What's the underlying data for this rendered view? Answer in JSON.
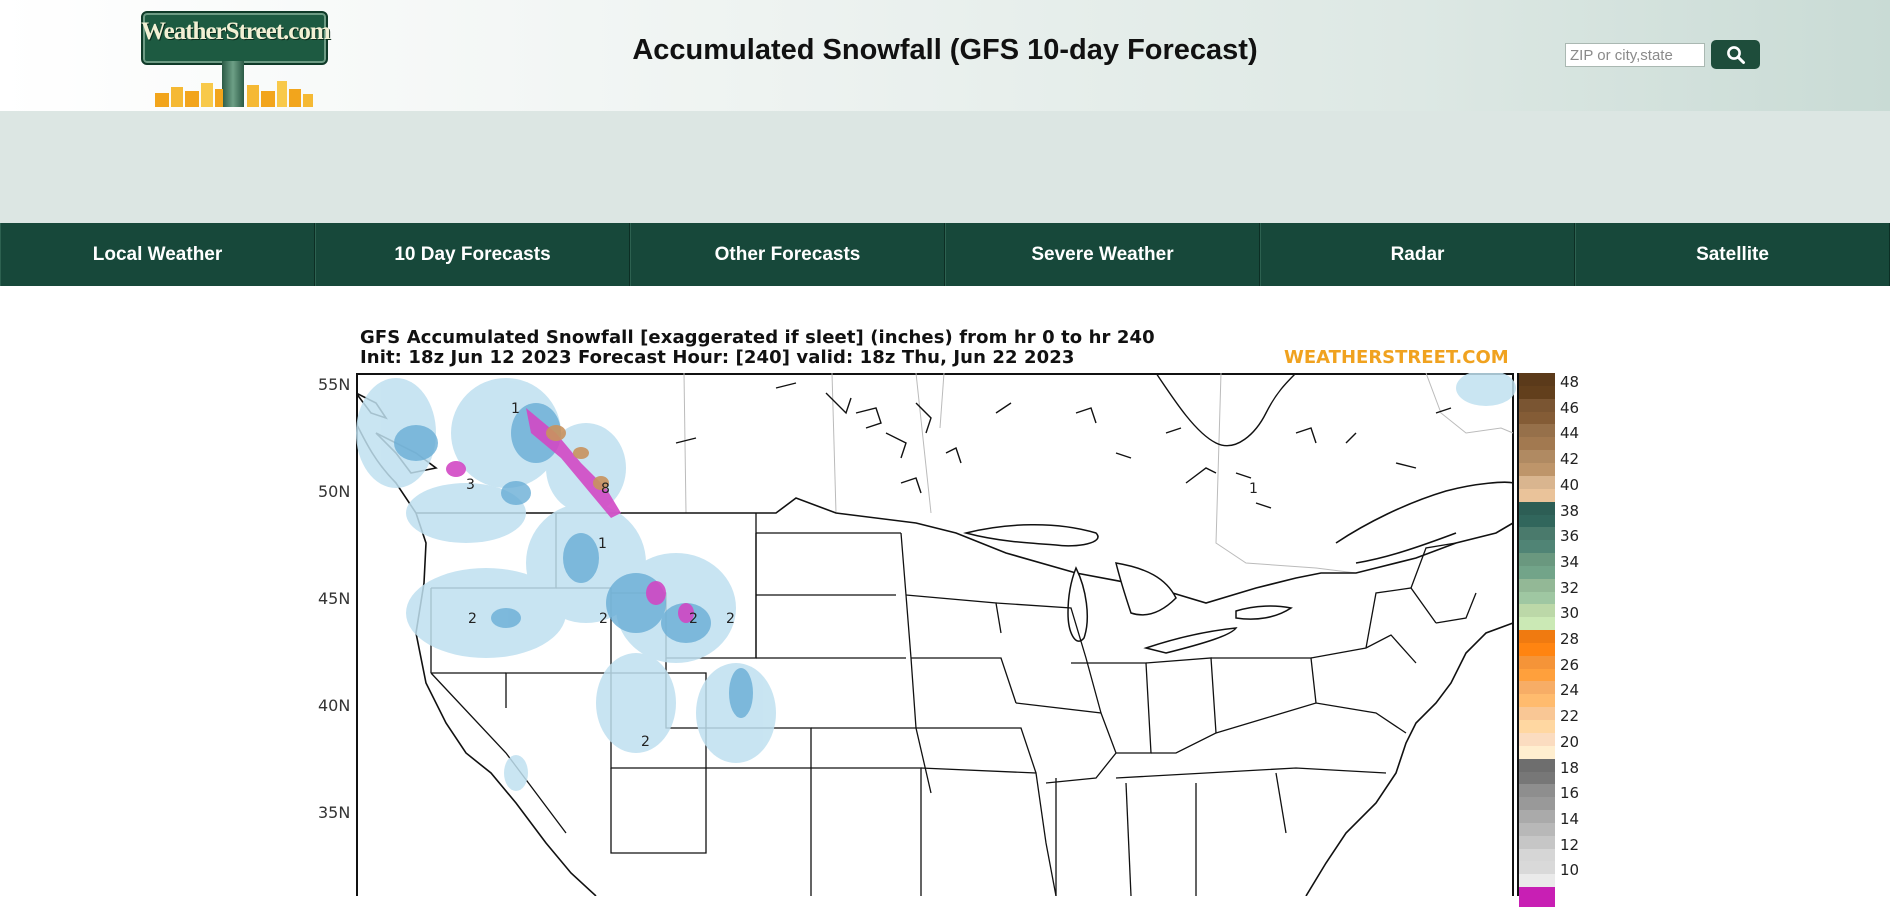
{
  "header": {
    "logo_text": "WeatherStreet.com",
    "title": "Accumulated Snowfall (GFS 10-day Forecast)",
    "search_placeholder": "ZIP or city,state",
    "search_icon": "search-icon"
  },
  "nav": {
    "items": [
      {
        "label": "Local Weather"
      },
      {
        "label": "10 Day Forecasts"
      },
      {
        "label": "Other Forecasts"
      },
      {
        "label": "Severe Weather"
      },
      {
        "label": "Radar"
      },
      {
        "label": "Satellite"
      }
    ]
  },
  "map": {
    "title_line1": "GFS Accumulated Snowfall [exaggerated if sleet]  (inches) from hr 0 to hr 240",
    "title_line2": "Init: 18z Jun 12 2023  Forecast Hour: [240]  valid: 18z Thu, Jun 22 2023",
    "brand": "WEATHERSTREET.COM",
    "lat_labels": [
      "55N",
      "50N",
      "45N",
      "40N",
      "35N"
    ],
    "snow_labels": [
      "1",
      "3",
      "8",
      "2",
      "2",
      "2",
      "2",
      "2",
      "1",
      "1"
    ],
    "legend": [
      {
        "label": "48",
        "color": "#5b3a1a"
      },
      {
        "label": "46",
        "color": "#7a5532"
      },
      {
        "label": "44",
        "color": "#96704a"
      },
      {
        "label": "42",
        "color": "#b08a62"
      },
      {
        "label": "40",
        "color": "#d9b58f"
      },
      {
        "label": "38",
        "color": "#2d5e55"
      },
      {
        "label": "36",
        "color": "#4a7a6c"
      },
      {
        "label": "34",
        "color": "#6a987f"
      },
      {
        "label": "32",
        "color": "#93b896"
      },
      {
        "label": "30",
        "color": "#bcd8a8"
      },
      {
        "label": "28",
        "color": "#f07a10"
      },
      {
        "label": "26",
        "color": "#f59438"
      },
      {
        "label": "24",
        "color": "#f7ad66"
      },
      {
        "label": "22",
        "color": "#f9c795"
      },
      {
        "label": "20",
        "color": "#fbdcc0"
      },
      {
        "label": "18",
        "color": "#6e6e6e"
      },
      {
        "label": "16",
        "color": "#8e8e8e"
      },
      {
        "label": "14",
        "color": "#aaaaaa"
      },
      {
        "label": "12",
        "color": "#c6c6c6"
      },
      {
        "label": "10",
        "color": "#d9d9d9"
      }
    ],
    "legend_bottom_color": "#c81fb4"
  }
}
